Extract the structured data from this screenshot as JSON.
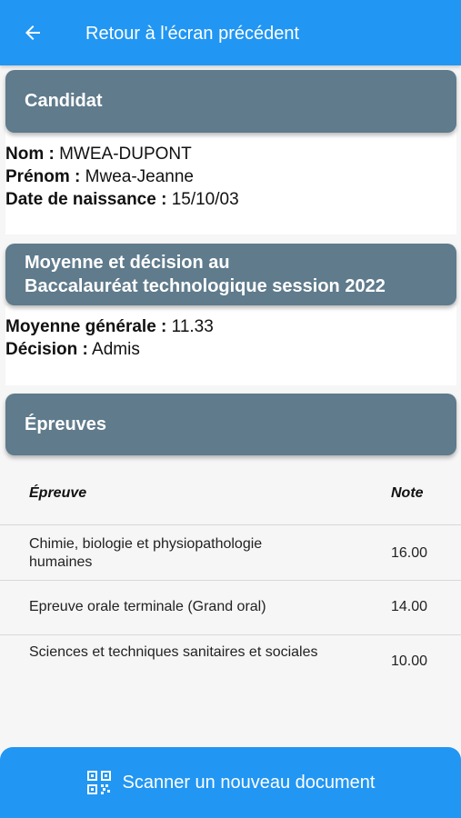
{
  "appbar": {
    "title": "Retour à l'écran précédent"
  },
  "candidat": {
    "header": "Candidat",
    "nom_label": "Nom :",
    "nom_value": "MWEA-DUPONT",
    "prenom_label": "Prénom :",
    "prenom_value": "Mwea-Jeanne",
    "naissance_label": "Date de naissance :",
    "naissance_value": "15/10/03"
  },
  "moyenne": {
    "header_line1": "Moyenne et décision au",
    "header_line2": "Baccalauréat technologique session 2022",
    "moyenne_label": "Moyenne générale :",
    "moyenne_value": "11.33",
    "decision_label": "Décision :",
    "decision_value": "Admis"
  },
  "epreuves": {
    "header": "Épreuves",
    "col_epreuve": "Épreuve",
    "col_note": "Note",
    "rows": [
      {
        "name": "Chimie, biologie et physiopathologie humaines",
        "note": "16.00"
      },
      {
        "name": "Epreuve orale terminale (Grand oral)",
        "note": "14.00"
      },
      {
        "name": "Sciences et techniques sanitaires et sociales",
        "note": "10.00"
      }
    ]
  },
  "scan_button": {
    "label": "Scanner un nouveau document"
  },
  "colors": {
    "primary": "#2196f3",
    "header_bg": "#5f7b8c"
  },
  "icons": {
    "back": "arrow-left-icon",
    "scan": "qr-code-icon"
  }
}
